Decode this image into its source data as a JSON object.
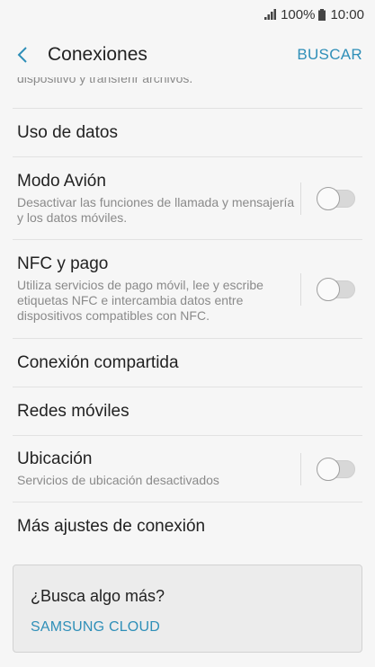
{
  "status": {
    "battery": "100%",
    "time": "10:00"
  },
  "header": {
    "title": "Conexiones",
    "search_label": "BUSCAR"
  },
  "cut_text": "dispositivo y transferir archivos.",
  "items": [
    {
      "label": "Uso de datos"
    },
    {
      "label": "Modo Avión",
      "desc": "Desactivar las funciones de llamada y mensajería y los datos móviles.",
      "toggle": "off"
    },
    {
      "label": "NFC y pago",
      "desc": "Utiliza servicios de pago móvil, lee y escribe etiquetas NFC e intercambia datos entre dispositivos compatibles con NFC.",
      "toggle": "off"
    },
    {
      "label": "Conexión compartida"
    },
    {
      "label": "Redes móviles"
    },
    {
      "label": "Ubicación",
      "desc": "Servicios de ubicación desactivados",
      "toggle": "off"
    },
    {
      "label": "Más ajustes de conexión"
    }
  ],
  "card": {
    "title": "¿Busca algo más?",
    "link": "SAMSUNG CLOUD"
  },
  "colors": {
    "accent": "#2f8fb8",
    "background": "#f6f6f6"
  }
}
